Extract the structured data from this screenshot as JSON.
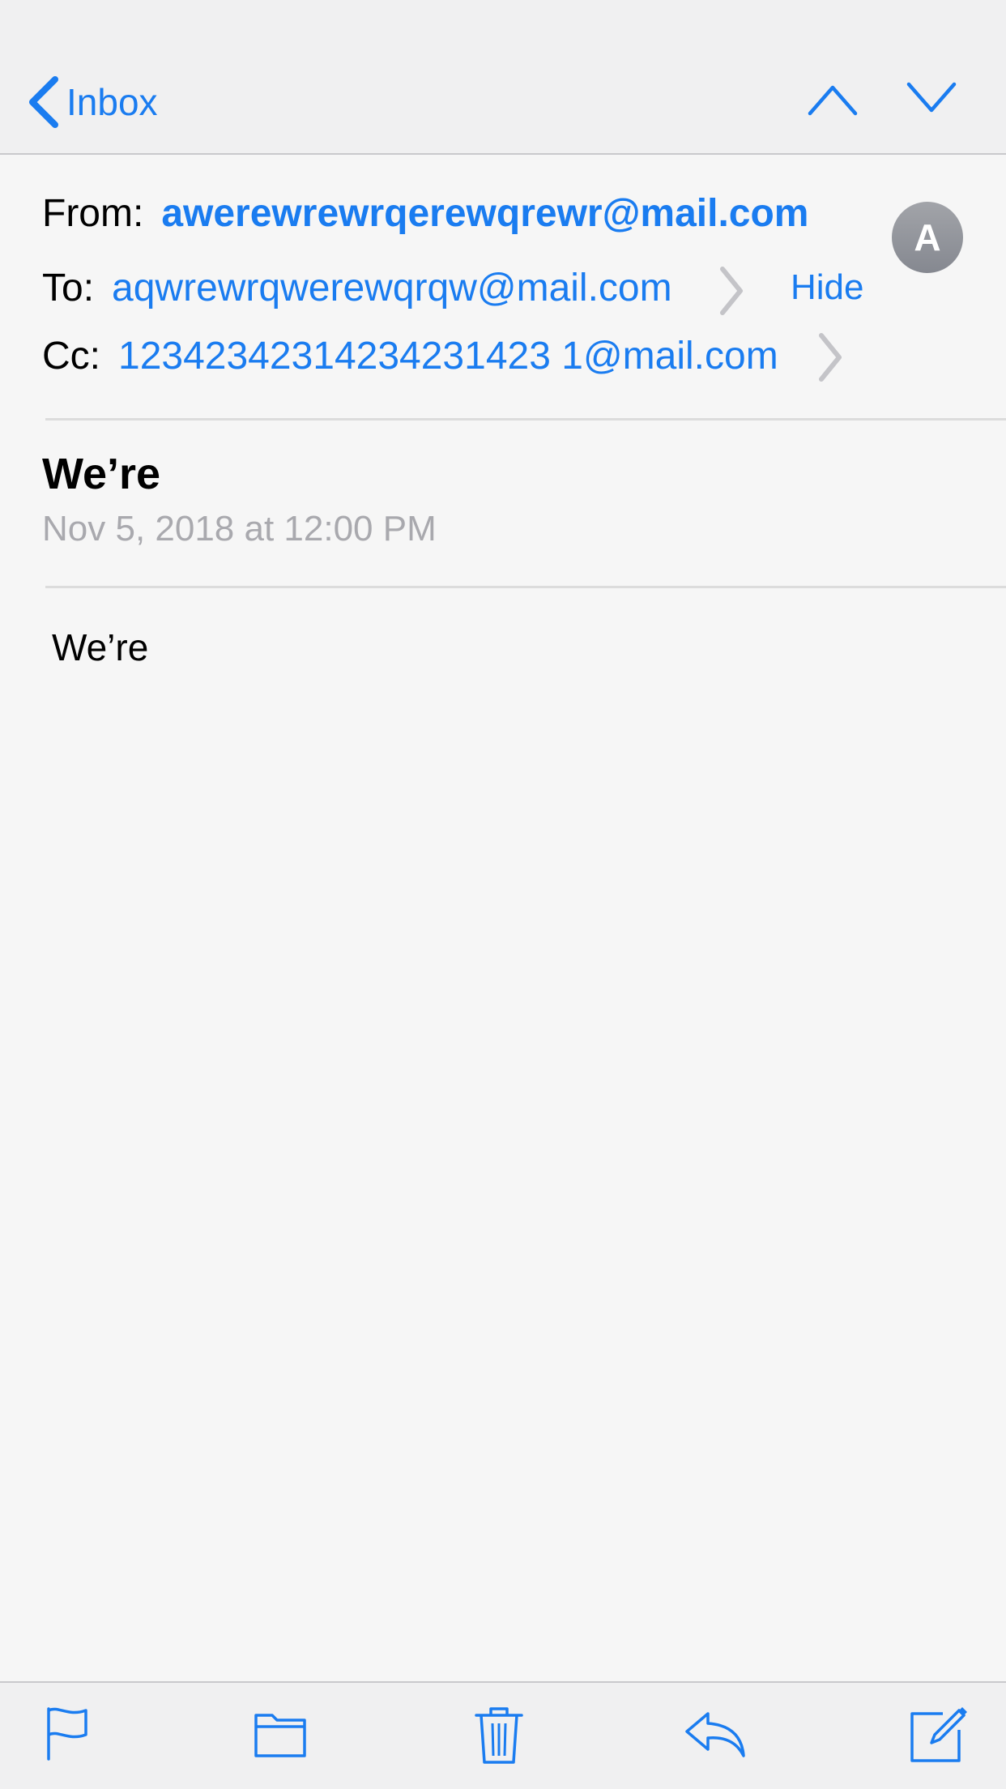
{
  "nav": {
    "back_label": "Inbox",
    "accent_color": "#1a7cf0"
  },
  "header": {
    "from_label": "From:",
    "from_address": "awerewrewrqerewqrewr@mail.com",
    "to_label": "To:",
    "to_address": "aqwrewrqwerewqrqw@mail.com",
    "cc_label": "Cc:",
    "cc_address": "12342342314234231423 1@mail.com",
    "hide_label": "Hide",
    "avatar_initial": "A"
  },
  "message": {
    "subject": "We’re",
    "date": "Nov 5, 2018 at 12:00 PM",
    "body": "We’re"
  },
  "toolbar": {
    "icons": [
      "flag-icon",
      "folder-icon",
      "trash-icon",
      "reply-icon",
      "compose-icon"
    ]
  }
}
